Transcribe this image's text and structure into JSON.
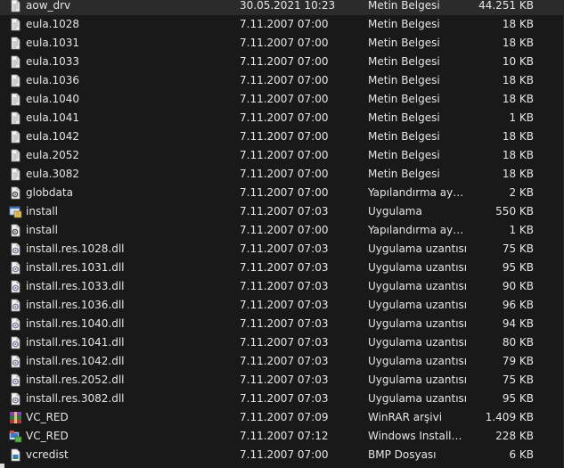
{
  "files": [
    {
      "name": "aow_drv",
      "date": "30.05.2021 10:23",
      "type": "Metin Belgesi",
      "size": "44.251 KB",
      "icon": "text-document-icon"
    },
    {
      "name": "eula.1028",
      "date": "7.11.2007 07:00",
      "type": "Metin Belgesi",
      "size": "18 KB",
      "icon": "text-document-icon"
    },
    {
      "name": "eula.1031",
      "date": "7.11.2007 07:00",
      "type": "Metin Belgesi",
      "size": "18 KB",
      "icon": "text-document-icon"
    },
    {
      "name": "eula.1033",
      "date": "7.11.2007 07:00",
      "type": "Metin Belgesi",
      "size": "10 KB",
      "icon": "text-document-icon"
    },
    {
      "name": "eula.1036",
      "date": "7.11.2007 07:00",
      "type": "Metin Belgesi",
      "size": "18 KB",
      "icon": "text-document-icon"
    },
    {
      "name": "eula.1040",
      "date": "7.11.2007 07:00",
      "type": "Metin Belgesi",
      "size": "18 KB",
      "icon": "text-document-icon"
    },
    {
      "name": "eula.1041",
      "date": "7.11.2007 07:00",
      "type": "Metin Belgesi",
      "size": "1 KB",
      "icon": "text-document-icon"
    },
    {
      "name": "eula.1042",
      "date": "7.11.2007 07:00",
      "type": "Metin Belgesi",
      "size": "18 KB",
      "icon": "text-document-icon"
    },
    {
      "name": "eula.2052",
      "date": "7.11.2007 07:00",
      "type": "Metin Belgesi",
      "size": "18 KB",
      "icon": "text-document-icon"
    },
    {
      "name": "eula.3082",
      "date": "7.11.2007 07:00",
      "type": "Metin Belgesi",
      "size": "18 KB",
      "icon": "text-document-icon"
    },
    {
      "name": "globdata",
      "date": "7.11.2007 07:00",
      "type": "Yapılandırma ayarl...",
      "size": "2 KB",
      "icon": "config-settings-icon"
    },
    {
      "name": "install",
      "date": "7.11.2007 07:03",
      "type": "Uygulama",
      "size": "550 KB",
      "icon": "installer-app-icon"
    },
    {
      "name": "install",
      "date": "7.11.2007 07:00",
      "type": "Yapılandırma ayarl...",
      "size": "1 KB",
      "icon": "config-settings-icon"
    },
    {
      "name": "install.res.1028.dll",
      "date": "7.11.2007 07:03",
      "type": "Uygulama uzantısı",
      "size": "75 KB",
      "icon": "dll-extension-icon"
    },
    {
      "name": "install.res.1031.dll",
      "date": "7.11.2007 07:03",
      "type": "Uygulama uzantısı",
      "size": "95 KB",
      "icon": "dll-extension-icon"
    },
    {
      "name": "install.res.1033.dll",
      "date": "7.11.2007 07:03",
      "type": "Uygulama uzantısı",
      "size": "90 KB",
      "icon": "dll-extension-icon"
    },
    {
      "name": "install.res.1036.dll",
      "date": "7.11.2007 07:03",
      "type": "Uygulama uzantısı",
      "size": "96 KB",
      "icon": "dll-extension-icon"
    },
    {
      "name": "install.res.1040.dll",
      "date": "7.11.2007 07:03",
      "type": "Uygulama uzantısı",
      "size": "94 KB",
      "icon": "dll-extension-icon"
    },
    {
      "name": "install.res.1041.dll",
      "date": "7.11.2007 07:03",
      "type": "Uygulama uzantısı",
      "size": "80 KB",
      "icon": "dll-extension-icon"
    },
    {
      "name": "install.res.1042.dll",
      "date": "7.11.2007 07:03",
      "type": "Uygulama uzantısı",
      "size": "79 KB",
      "icon": "dll-extension-icon"
    },
    {
      "name": "install.res.2052.dll",
      "date": "7.11.2007 07:03",
      "type": "Uygulama uzantısı",
      "size": "75 KB",
      "icon": "dll-extension-icon"
    },
    {
      "name": "install.res.3082.dll",
      "date": "7.11.2007 07:03",
      "type": "Uygulama uzantısı",
      "size": "95 KB",
      "icon": "dll-extension-icon"
    },
    {
      "name": "VC_RED",
      "date": "7.11.2007 07:09",
      "type": "WinRAR arşivi",
      "size": "1.409 KB",
      "icon": "winrar-archive-icon"
    },
    {
      "name": "VC_RED",
      "date": "7.11.2007 07:12",
      "type": "Windows Installer ...",
      "size": "228 KB",
      "icon": "msi-installer-icon"
    },
    {
      "name": "vcredist",
      "date": "7.11.2007 07:00",
      "type": "BMP Dosyası",
      "size": "6 KB",
      "icon": "bitmap-image-icon"
    }
  ],
  "colors": {
    "background": "#191919",
    "text": "#e6e6e6"
  }
}
